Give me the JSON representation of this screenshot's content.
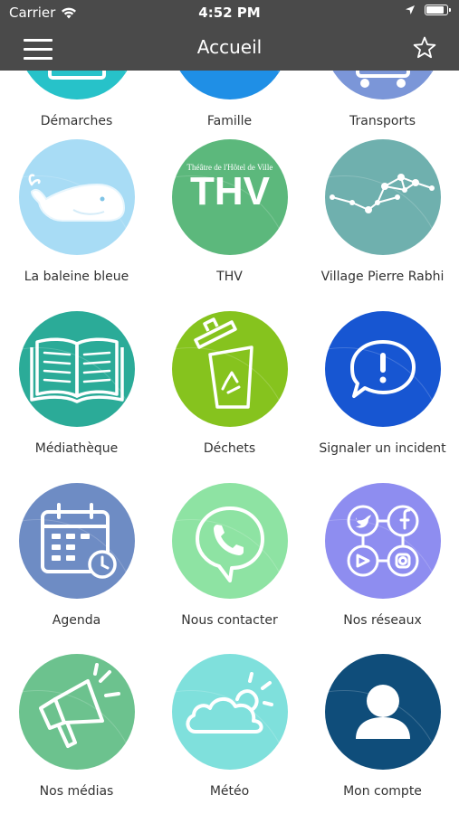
{
  "status_bar": {
    "carrier": "Carrier",
    "time": "4:52 PM"
  },
  "nav": {
    "title": "Accueil"
  },
  "tiles": [
    {
      "label": "Démarches",
      "color": "#27c2c9",
      "icon": "folder-icon"
    },
    {
      "label": "Famille",
      "color": "#1f8fe6",
      "icon": "family-icon"
    },
    {
      "label": "Transports",
      "color": "#7b96d8",
      "icon": "bus-icon"
    },
    {
      "label": "La baleine bleue",
      "color": "#a8dcf5",
      "icon": "whale-icon"
    },
    {
      "label": "THV",
      "color": "#5cb87c",
      "icon": "thv-logo-icon",
      "logo_text": "THV",
      "logo_caption": "Théâtre de l'Hôtel de Ville"
    },
    {
      "label": "Village Pierre Rabhi",
      "color": "#6fb0ae",
      "icon": "constellation-icon"
    },
    {
      "label": "Médiathèque",
      "color": "#2bab98",
      "icon": "book-icon"
    },
    {
      "label": "Déchets",
      "color": "#86c31e",
      "icon": "recycle-bin-icon"
    },
    {
      "label": "Signaler un incident",
      "color": "#1756d2",
      "icon": "alert-bubble-icon"
    },
    {
      "label": "Agenda",
      "color": "#6e8cc4",
      "icon": "calendar-icon"
    },
    {
      "label": "Nous contacter",
      "color": "#8ee3a3",
      "icon": "phone-bubble-icon"
    },
    {
      "label": "Nos réseaux",
      "color": "#8e8df0",
      "icon": "social-icon"
    },
    {
      "label": "Nos médias",
      "color": "#6cc28e",
      "icon": "megaphone-icon"
    },
    {
      "label": "Météo",
      "color": "#7fe0dc",
      "icon": "weather-icon"
    },
    {
      "label": "Mon compte",
      "color": "#0f4d7a",
      "icon": "user-icon"
    }
  ]
}
